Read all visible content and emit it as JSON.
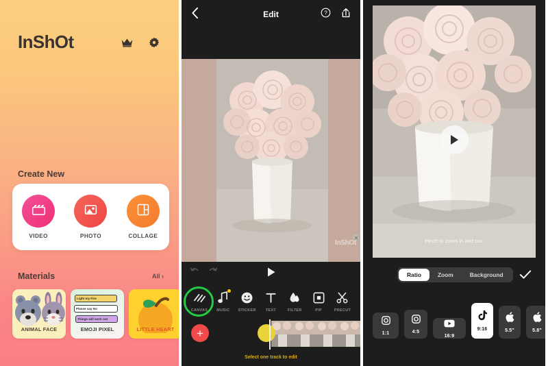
{
  "app": {
    "name": "InShot"
  },
  "panel_home": {
    "logo": "InShOt",
    "icons": [
      {
        "name": "crown-icon",
        "label": "crown"
      },
      {
        "name": "gear-icon",
        "label": "settings"
      }
    ],
    "create_new_label": "Create New",
    "create_new_items": [
      {
        "label": "VIDEO",
        "icon": "clapperboard-icon",
        "color": "#f0457f"
      },
      {
        "label": "PHOTO",
        "icon": "image-icon",
        "color": "#f2594f"
      },
      {
        "label": "COLLAGE",
        "icon": "collage-icon",
        "color": "#f58634"
      }
    ],
    "materials_title": "Materials",
    "materials_all": "All",
    "materials_all_chevron": "›",
    "materials": [
      {
        "label": "ANIMAL FACE",
        "theme": "animal"
      },
      {
        "label": "EMOJI PIXEL",
        "theme": "emoji",
        "chips": [
          "Light my Fire",
          "Please say No",
          "Things will work out"
        ]
      },
      {
        "label": "LITTLE HEART",
        "theme": "fruit"
      }
    ]
  },
  "panel_edit": {
    "title": "Edit",
    "back_icon": "chevron-left-icon",
    "help_icon": "question-circle-icon",
    "share_icon": "share-upload-icon",
    "watermark": "InShOt",
    "undo_icon": "undo-icon",
    "redo_icon": "redo-icon",
    "play_icon": "play-icon",
    "tools": [
      {
        "label": "CANVAS",
        "icon": "canvas-icon",
        "highlighted": true
      },
      {
        "label": "MUSIC",
        "icon": "music-note-icon",
        "badge": true
      },
      {
        "label": "STICKER",
        "icon": "sticker-smiley-icon"
      },
      {
        "label": "TEXT",
        "icon": "text-t-icon"
      },
      {
        "label": "FILTER",
        "icon": "filter-drop-icon"
      },
      {
        "label": "PIP",
        "icon": "pip-square-icon"
      },
      {
        "label": "PRECUT",
        "icon": "scissors-icon"
      }
    ],
    "add_track_label": "+",
    "timeline_hint": "Select one track to edit"
  },
  "panel_ratio": {
    "pinch_hint": "Pinch to zoom in and out.",
    "play_icon": "play-icon",
    "confirm_icon": "check-icon",
    "segments": [
      {
        "label": "Ratio",
        "active": true
      },
      {
        "label": "Zoom",
        "active": false
      },
      {
        "label": "Background",
        "active": false
      }
    ],
    "ratios": [
      {
        "label": "1:1",
        "icon": "instagram-icon",
        "selected": false
      },
      {
        "label": "4:5",
        "icon": "instagram-icon",
        "selected": false
      },
      {
        "label": "16:9",
        "icon": "youtube-icon",
        "selected": false
      },
      {
        "label": "9:16",
        "icon": "tiktok-icon",
        "selected": true
      },
      {
        "label": "5.5\"",
        "icon": "apple-icon",
        "selected": false
      },
      {
        "label": "5.8\"",
        "icon": "apple-icon",
        "selected": false
      }
    ]
  },
  "colors": {
    "home_gradient_top": "#fbcf7f",
    "home_gradient_bottom": "#fa7f84",
    "dark_bg": "#1d1d1d",
    "accent_red": "#f04a4a",
    "highlight_green": "#22cc44",
    "hint_yellow": "#d7ae22"
  }
}
